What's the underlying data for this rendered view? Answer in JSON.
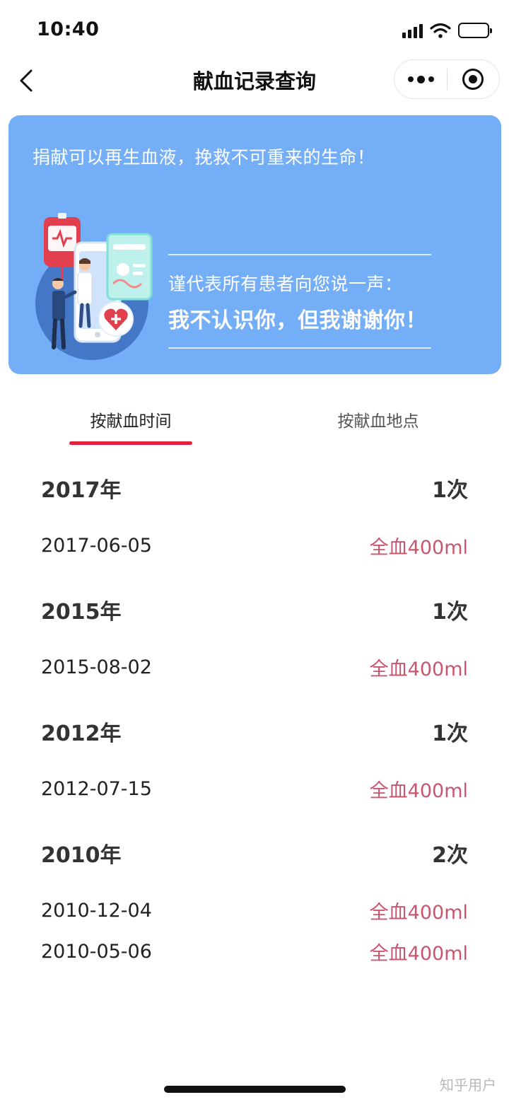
{
  "status_bar": {
    "time": "10:40"
  },
  "nav": {
    "title": "献血记录查询"
  },
  "banner": {
    "slogan": "捐献可以再生血液，挽救不可重来的生命！",
    "thanks_sub": "谨代表所有患者向您说一声：",
    "thanks_main": "我不认识你，但我谢谢你！"
  },
  "tabs": [
    {
      "label": "按献血时间",
      "active": true
    },
    {
      "label": "按献血地点",
      "active": false
    }
  ],
  "records": [
    {
      "year": "2017年",
      "count": "1次",
      "entries": [
        {
          "date": "2017-06-05",
          "volume": "全血400ml"
        }
      ]
    },
    {
      "year": "2015年",
      "count": "1次",
      "entries": [
        {
          "date": "2015-08-02",
          "volume": "全血400ml"
        }
      ]
    },
    {
      "year": "2012年",
      "count": "1次",
      "entries": [
        {
          "date": "2012-07-15",
          "volume": "全血400ml"
        }
      ]
    },
    {
      "year": "2010年",
      "count": "2次",
      "entries": [
        {
          "date": "2010-12-04",
          "volume": "全血400ml"
        },
        {
          "date": "2010-05-06",
          "volume": "全血400ml"
        }
      ]
    }
  ],
  "watermark": "知乎用户",
  "colors": {
    "banner": "#74aef6",
    "tab_underline": "#e0213c",
    "volume_text": "#c8566f"
  }
}
